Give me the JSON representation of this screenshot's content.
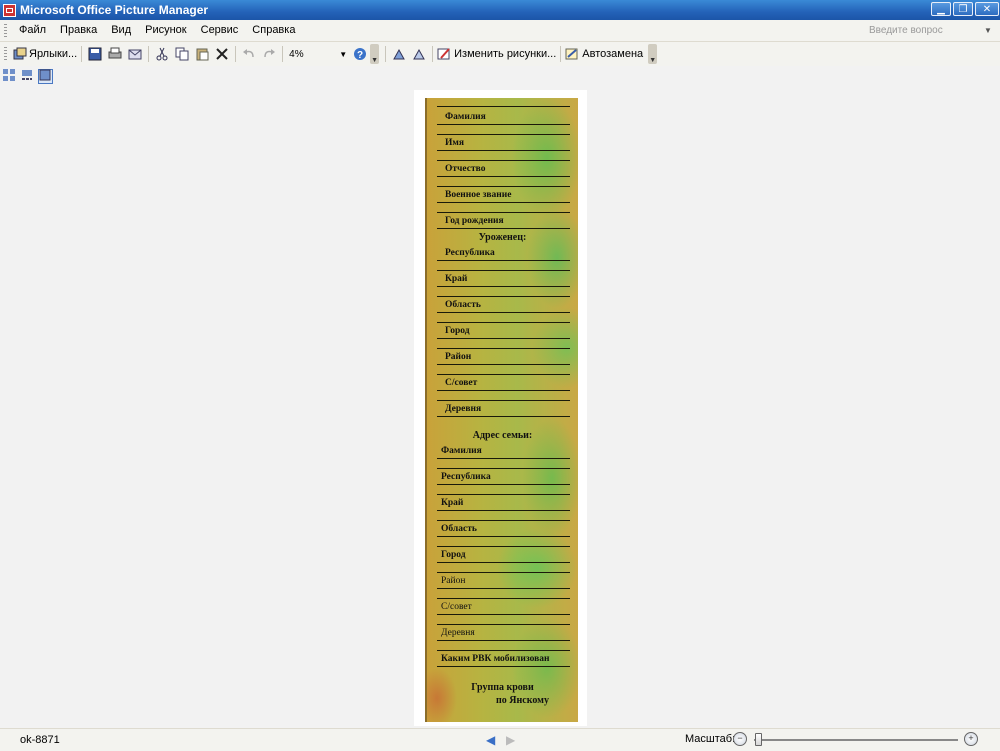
{
  "window": {
    "title": "Microsoft Office Picture Manager"
  },
  "menu": {
    "items": [
      "Файл",
      "Правка",
      "Вид",
      "Рисунок",
      "Сервис",
      "Справка"
    ],
    "help_placeholder": "Введите вопрос"
  },
  "toolbar": {
    "shortcuts_label": "Ярлыки...",
    "zoom_value": "4%",
    "edit_pictures_label": "Изменить рисунки...",
    "autocorrect_label": "Автозамена"
  },
  "document": {
    "heading_native": "Уроженец:",
    "heading_family": "Адрес семьи:",
    "labels_top": [
      "Фамилия",
      "Имя",
      "Отчество",
      "Военное звание",
      "Год рождения"
    ],
    "labels_native": [
      "Республика",
      "Край",
      "Область",
      "Город",
      "Район",
      "С/совет",
      "Деревня"
    ],
    "labels_family": [
      "Фамилия",
      "Республика",
      "Край",
      "Область",
      "Город",
      "Район",
      "С/совет",
      "Деревня",
      "Каким РВК мобилизован"
    ],
    "footer_line1": "Группа крови",
    "footer_line2": "по Янскому"
  },
  "status": {
    "file_name": "ok-8871",
    "zoom_label": "Масштаб:"
  }
}
